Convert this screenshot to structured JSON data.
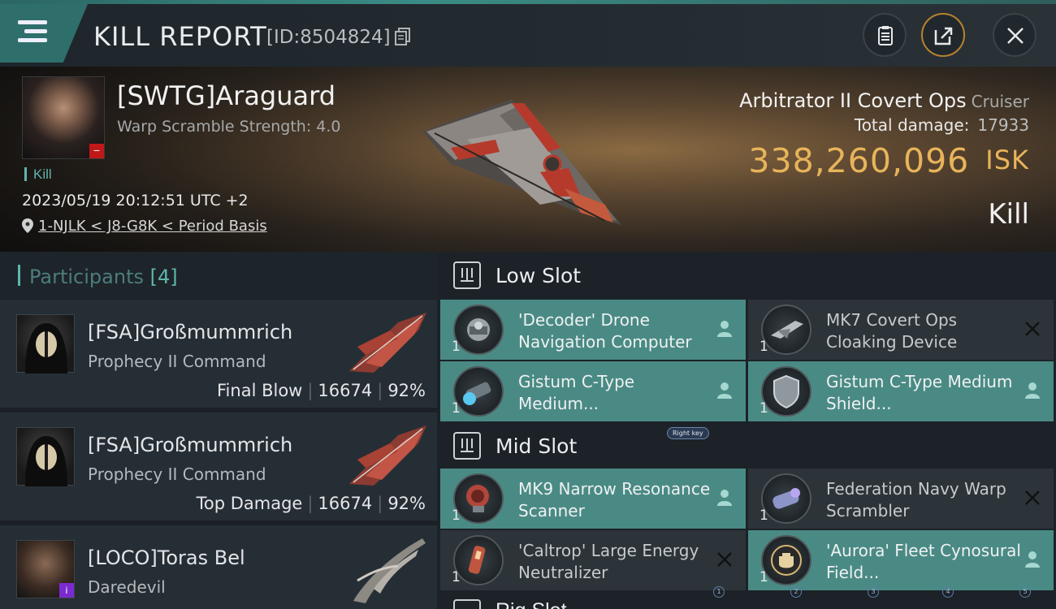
{
  "header": {
    "title": "KILL REPORT",
    "report_id": "[ID:8504824]"
  },
  "victim": {
    "name": "[SWTG]Araguard",
    "subtitle": "Warp Scramble Strength: 4.0",
    "kill_tag": "Kill",
    "timestamp": "2023/05/19 20:12:51 UTC +2",
    "location": "1-NJLK < J8-G8K < Period Basis",
    "ship_name": "Arbitrator II Covert Ops",
    "ship_class": "Cruiser",
    "total_damage_label": "Total damage:",
    "total_damage": "17933",
    "isk_value": "338,260,096",
    "isk_unit": "ISK",
    "result": "Kill"
  },
  "participants": {
    "label": "Participants",
    "count": "[4]",
    "items": [
      {
        "name": "[FSA]Großmummrich",
        "ship": "Prophecy II Command",
        "role": "Final Blow",
        "damage": "16674",
        "percent": "92%"
      },
      {
        "name": "[FSA]Großmummrich",
        "ship": "Prophecy II Command",
        "role": "Top Damage",
        "damage": "16674",
        "percent": "92%"
      },
      {
        "name": "[LOCO]Toras Bel",
        "ship": "Daredevil",
        "role": "",
        "damage": "",
        "percent": ""
      }
    ]
  },
  "sections": {
    "low_slot": "Low Slot",
    "mid_slot": "Mid Slot",
    "next_slot": "Rig Slot"
  },
  "low_modules": [
    {
      "name": "'Decoder' Drone Navigation Computer",
      "qty": "1",
      "state": "fitted"
    },
    {
      "name": "MK7 Covert Ops Cloaking Device",
      "qty": "1",
      "state": "destroyed"
    },
    {
      "name": "Gistum C-Type Medium...",
      "qty": "1",
      "state": "fitted"
    },
    {
      "name": "Gistum C-Type Medium Shield...",
      "qty": "1",
      "state": "fitted"
    }
  ],
  "mid_modules": [
    {
      "name": "MK9 Narrow Resonance Scanner",
      "qty": "1",
      "state": "fitted"
    },
    {
      "name": "Federation Navy Warp Scrambler",
      "qty": "1",
      "state": "destroyed"
    },
    {
      "name": "'Caltrop' Large Energy Neutralizer",
      "qty": "1",
      "state": "destroyed"
    },
    {
      "name": "'Aurora' Fleet Cynosural Field...",
      "qty": "1",
      "state": "fitted"
    }
  ],
  "overlay": {
    "right_key": "Right key",
    "pager": [
      "1",
      "2",
      "3",
      "4",
      "5"
    ]
  },
  "colors": {
    "accent_teal": "#5fb5ad",
    "fitted_bg": "#4a8a84",
    "isk_gold": "#e8b45a",
    "header_teal": "#2f6f6b"
  }
}
